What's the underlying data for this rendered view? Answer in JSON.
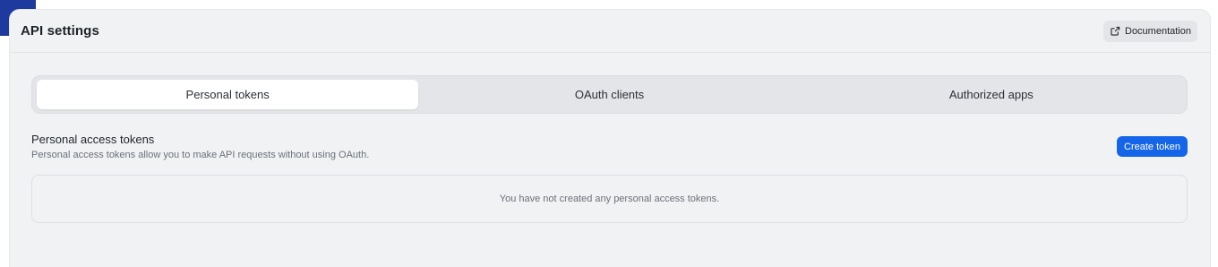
{
  "header": {
    "title": "API settings",
    "documentation_label": "Documentation"
  },
  "tabs": [
    {
      "label": "Personal tokens",
      "active": true
    },
    {
      "label": "OAuth clients",
      "active": false
    },
    {
      "label": "Authorized apps",
      "active": false
    }
  ],
  "section": {
    "title": "Personal access tokens",
    "description": "Personal access tokens allow you to make API requests without using OAuth.",
    "create_label": "Create token",
    "empty_message": "You have not created any personal access tokens."
  },
  "colors": {
    "accent": "#1565e8",
    "panel_bg": "#f1f2f4"
  },
  "icons": {
    "documentation": "external-link-icon"
  }
}
